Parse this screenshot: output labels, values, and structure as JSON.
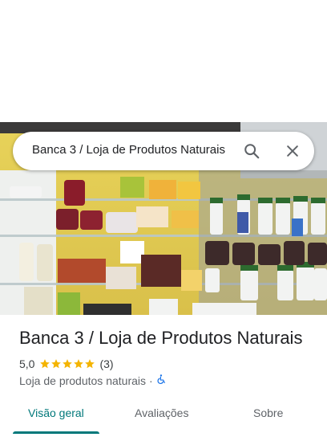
{
  "search": {
    "query": "Banca 3 / Loja de Produtos Naturais",
    "search_icon": "search-icon",
    "close_icon": "close-icon"
  },
  "photo": {
    "subject": "store-shelves-photo"
  },
  "place": {
    "title": "Banca 3 / Loja de Produtos Naturais",
    "rating_value": "5,0",
    "star_count": 5,
    "review_count": "(3)",
    "category": "Loja de produtos naturais",
    "separator": "·",
    "accessibility_icon": "wheelchair-icon"
  },
  "tabs": [
    {
      "label": "Visão geral",
      "active": true
    },
    {
      "label": "Avaliações",
      "active": false
    },
    {
      "label": "Sobre",
      "active": false
    }
  ],
  "colors": {
    "accent": "#00787a",
    "star": "#f4b400",
    "accessibility": "#1a73e8"
  }
}
